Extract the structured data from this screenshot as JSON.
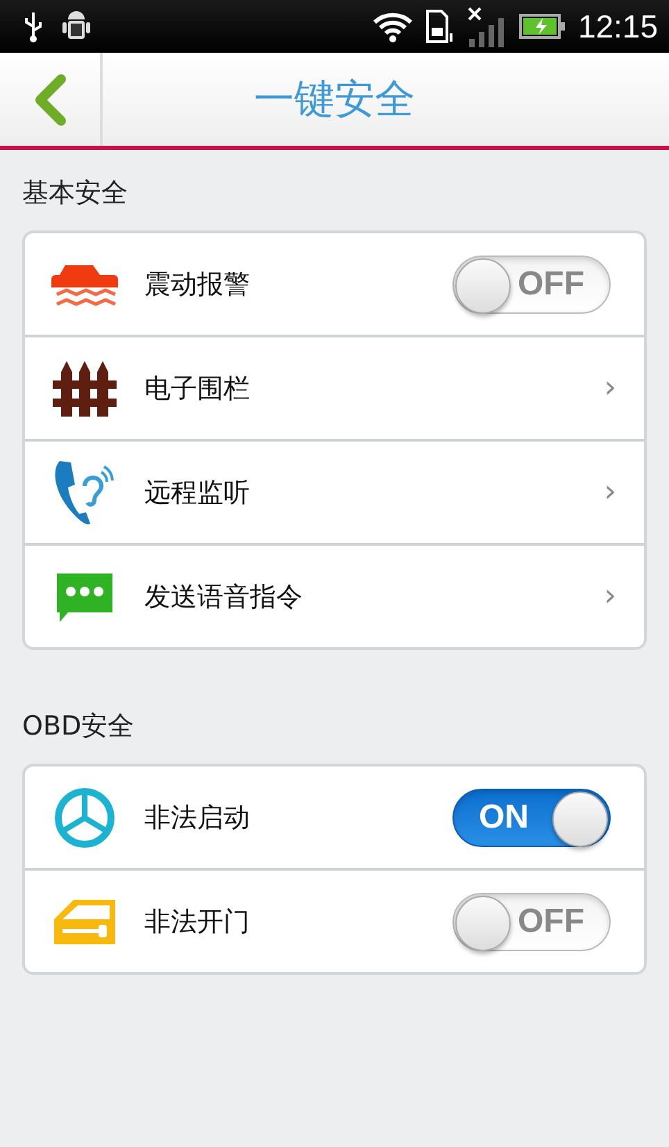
{
  "status_bar": {
    "time": "12:15"
  },
  "header": {
    "title": "一键安全"
  },
  "sections": [
    {
      "title": "基本安全",
      "rows": [
        {
          "kind": "toggle",
          "label": "震动报警",
          "on": false,
          "switch_text": "OFF"
        },
        {
          "kind": "link",
          "label": "电子围栏",
          "chevron": "›"
        },
        {
          "kind": "link",
          "label": "远程监听",
          "chevron": "›"
        },
        {
          "kind": "link",
          "label": "发送语音指令",
          "chevron": "›"
        }
      ]
    },
    {
      "title": "OBD安全",
      "rows": [
        {
          "kind": "toggle",
          "label": "非法启动",
          "on": true,
          "switch_text": "ON"
        },
        {
          "kind": "toggle",
          "label": "非法开门",
          "on": false,
          "switch_text": "OFF"
        }
      ]
    }
  ]
}
